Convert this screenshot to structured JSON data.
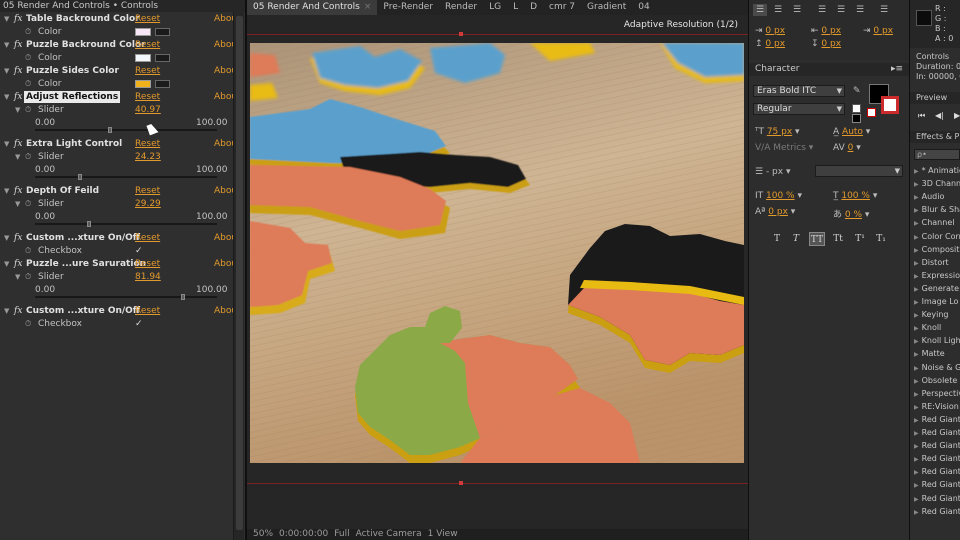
{
  "effect_controls": {
    "title": "05 Render And Controls • Controls",
    "effects": [
      {
        "name": "Table Backround Color",
        "reset": "Reset",
        "about": "Abou",
        "prop_label": "Color",
        "prop_type": "color",
        "color": "#f6e6f6"
      },
      {
        "name": "Puzzle Backround Color",
        "reset": "Reset",
        "about": "Abou",
        "prop_label": "Color",
        "prop_type": "color",
        "color": "#f2f7fb"
      },
      {
        "name": "Puzzle Sides Color",
        "reset": "Reset",
        "about": "Abou",
        "prop_label": "Color",
        "prop_type": "color",
        "color": "#f0b21a"
      },
      {
        "name": "Adjust Reflections",
        "reset": "Reset",
        "about": "Abou",
        "prop_label": "Slider",
        "prop_type": "slider",
        "value": "40.97",
        "min": "0.00",
        "max": "100.00",
        "fraction": 0.4097,
        "highlighted": true
      },
      {
        "name": "Extra Light Control",
        "reset": "Reset",
        "about": "Abou",
        "prop_label": "Slider",
        "prop_type": "slider",
        "value": "24.23",
        "min": "0.00",
        "max": "100.00",
        "fraction": 0.2423
      },
      {
        "name": "Depth Of Feild",
        "reset": "Reset",
        "about": "Abou",
        "prop_label": "Slider",
        "prop_type": "slider",
        "value": "29.29",
        "min": "0.00",
        "max": "100.00",
        "fraction": 0.2929
      },
      {
        "name": "Custom ...xture On/Off",
        "reset": "Reset",
        "about": "Abou",
        "prop_label": "Checkbox",
        "prop_type": "checkbox",
        "checked": "✓"
      },
      {
        "name": "Puzzle ...ure Saruration",
        "reset": "Reset",
        "about": "Abou",
        "prop_label": "Slider",
        "prop_type": "slider",
        "value": "81.94",
        "min": "0.00",
        "max": "100.00",
        "fraction": 0.8194
      },
      {
        "name": "Custom ...xture On/Off",
        "reset": "Reset",
        "about": "Abou",
        "prop_label": "Checkbox",
        "prop_type": "checkbox",
        "checked": "✓"
      }
    ]
  },
  "viewer": {
    "tabs": [
      {
        "label": "05 Render And Controls",
        "active": true
      },
      {
        "label": "Pre-Render"
      },
      {
        "label": "Render"
      },
      {
        "label": "LG"
      },
      {
        "label": "L"
      },
      {
        "label": "D"
      },
      {
        "label": "cmr 7"
      },
      {
        "label": "Gradient"
      },
      {
        "label": "04"
      }
    ],
    "resolution_label": "Adaptive Resolution (1/2)",
    "bottom_bar": [
      "50%",
      "0:00:00:00",
      "Full",
      "Active Camera",
      "1 View"
    ]
  },
  "paragraph": {
    "indents": [
      "0 px",
      "0 px",
      "0 px",
      "0 px",
      "0 px"
    ]
  },
  "character": {
    "title": "Character",
    "font": "Eras Bold ITC",
    "style": "Regular",
    "size": "75 px",
    "leading": "Auto",
    "kerning": "Metrics",
    "tracking": "0",
    "stroke_width": "- px",
    "vscale": "100 %",
    "hscale": "100 %",
    "baseline": "0 px",
    "tsume": "0 %",
    "fill_color": "#000000",
    "format_buttons": [
      "T",
      "T",
      "TT",
      "Tt",
      "T¹",
      "T₁"
    ]
  },
  "info": {
    "channels": [
      "R :",
      "G :",
      "B :",
      "A : 0"
    ],
    "controls_label": "Controls",
    "duration": "Duration: 0",
    "in": "In: 00000, Ou"
  },
  "preview": {
    "title": "Preview"
  },
  "effects_presets": {
    "title": "Effects & P",
    "search_placeholder": "ρ•",
    "categories": [
      "* Animatio",
      "3D Channe",
      "Audio",
      "Blur & Sha",
      "Channel",
      "Color Corr",
      "Composit",
      "Distort",
      "Expressio",
      "Generate",
      "Image Lo",
      "Keying",
      "Knoll",
      "Knoll Ligh",
      "Matte",
      "Noise & G",
      "Obsolete",
      "Perspectiv",
      "RE:Vision",
      "Red Giant",
      "Red Giant",
      "Red Giant",
      "Red Giant",
      "Red Giant",
      "Red Giant",
      "Red Giant",
      "Red Giant"
    ]
  },
  "colors": {
    "accent": "#e39a2d",
    "table_wood": "#c8a57b",
    "piece_blue": "#5fa7d6",
    "piece_orange": "#e8805c",
    "piece_black": "#1c1c1c",
    "piece_green": "#92b04a",
    "piece_yellow": "#f2c313"
  }
}
